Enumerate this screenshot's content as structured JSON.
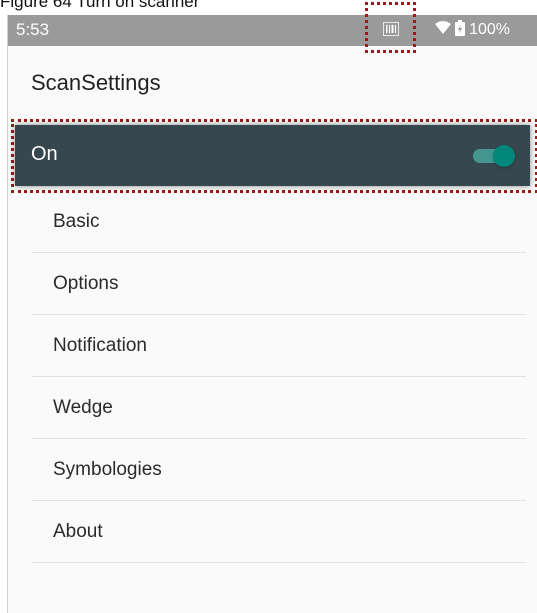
{
  "caption": "Figure 64 Turn on scanner",
  "status_bar": {
    "time": "5:53",
    "battery_pct": "100%",
    "icons": [
      "barcode-scanner-icon",
      "wifi-icon",
      "battery-icon"
    ]
  },
  "app": {
    "title": "ScanSettings"
  },
  "scanner_toggle": {
    "label": "On",
    "state": true
  },
  "menu": {
    "items": [
      {
        "label": "Basic"
      },
      {
        "label": "Options"
      },
      {
        "label": "Notification"
      },
      {
        "label": "Wedge"
      },
      {
        "label": "Symbologies"
      },
      {
        "label": "About"
      }
    ]
  },
  "colors": {
    "toggle_bar": "#37474f",
    "switch_on": "#00897b",
    "highlight": "#9b1b1b"
  }
}
